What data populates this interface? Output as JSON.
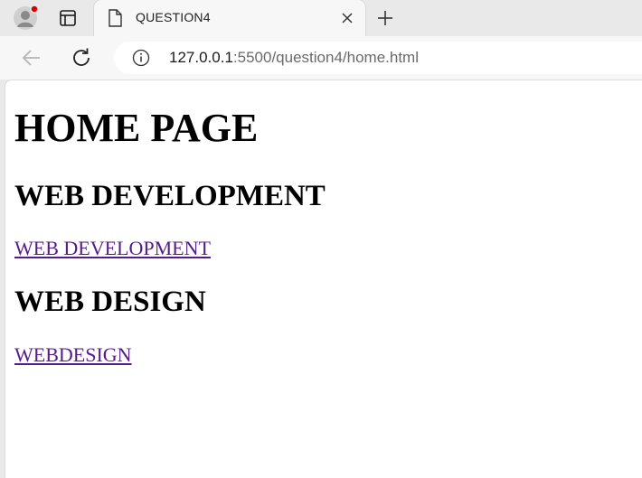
{
  "browser": {
    "tab": {
      "title": "QUESTION4"
    },
    "address": {
      "host": "127.0.0.1",
      "rest": ":5500/question4/home.html"
    }
  },
  "page": {
    "heading": "HOME PAGE",
    "sections": [
      {
        "heading": "WEB DEVELOPMENT",
        "link_text": "WEB DEVELOPMENT"
      },
      {
        "heading": "WEB DESIGN",
        "link_text": "WEBDESIGN"
      }
    ]
  },
  "colors": {
    "visited_link": "#551a8b",
    "profile_badge": "#d40000"
  }
}
